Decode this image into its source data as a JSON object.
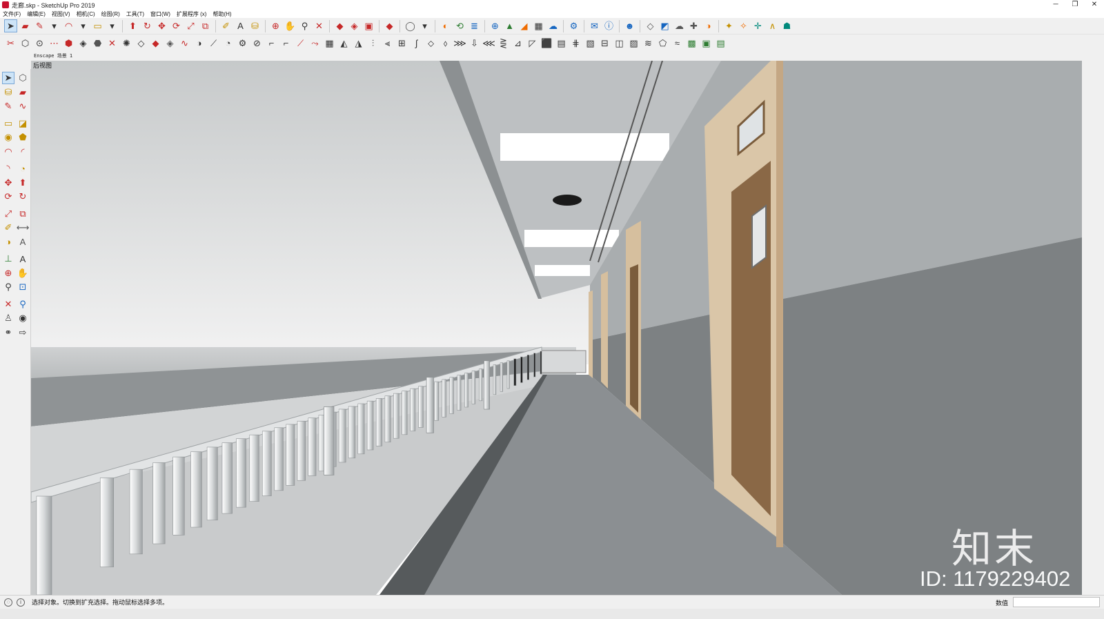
{
  "window": {
    "title": "走廊.skp - SketchUp Pro 2019",
    "controls": {
      "minimize": "─",
      "restore": "❐",
      "close": "✕"
    }
  },
  "menu": [
    "文件(F)",
    "编辑(E)",
    "视图(V)",
    "相机(C)",
    "绘图(R)",
    "工具(T)",
    "窗口(W)",
    "扩展程序 (x)",
    "帮助(H)"
  ],
  "toolbar_row1": [
    {
      "name": "select-icon",
      "glyph": "➤",
      "color": "dark",
      "selected": true
    },
    {
      "name": "eraser-icon",
      "glyph": "▰",
      "color": "red"
    },
    {
      "name": "pencil-icon",
      "glyph": "✎",
      "color": "red"
    },
    {
      "name": "line-dropdown-icon",
      "glyph": "▾",
      "color": "dark"
    },
    {
      "name": "arc-icon",
      "glyph": "◠",
      "color": "red"
    },
    {
      "name": "arc-dropdown-icon",
      "glyph": "▾",
      "color": "dark"
    },
    {
      "name": "rectangle-icon",
      "glyph": "▭",
      "color": "yellow"
    },
    {
      "name": "shape-dropdown-icon",
      "glyph": "▾",
      "color": "dark"
    },
    {
      "name": "sep"
    },
    {
      "name": "push-pull-icon",
      "glyph": "⬆",
      "color": "red"
    },
    {
      "name": "follow-me-icon",
      "glyph": "↻",
      "color": "red"
    },
    {
      "name": "move-icon",
      "glyph": "✥",
      "color": "red"
    },
    {
      "name": "rotate-icon",
      "glyph": "⟳",
      "color": "red"
    },
    {
      "name": "scale-icon",
      "glyph": "⤢",
      "color": "red"
    },
    {
      "name": "offset-icon",
      "glyph": "⧉",
      "color": "red"
    },
    {
      "name": "sep"
    },
    {
      "name": "tape-measure-icon",
      "glyph": "✐",
      "color": "yellow"
    },
    {
      "name": "text-icon",
      "glyph": "A",
      "color": "dark"
    },
    {
      "name": "paint-bucket-icon",
      "glyph": "⛁",
      "color": "yellow"
    },
    {
      "name": "sep"
    },
    {
      "name": "orbit-icon",
      "glyph": "⊕",
      "color": "red"
    },
    {
      "name": "pan-icon",
      "glyph": "✋",
      "color": "yellow"
    },
    {
      "name": "zoom-icon",
      "glyph": "⚲",
      "color": "dark"
    },
    {
      "name": "zoom-extents-icon",
      "glyph": "✕",
      "color": "red"
    },
    {
      "name": "sep"
    },
    {
      "name": "warehouse-icon",
      "glyph": "◆",
      "color": "red"
    },
    {
      "name": "extension-warehouse-icon",
      "glyph": "◈",
      "color": "red"
    },
    {
      "name": "share-model-icon",
      "glyph": "▣",
      "color": "red"
    },
    {
      "name": "sep"
    },
    {
      "name": "ruby-icon",
      "glyph": "◆",
      "color": "red"
    },
    {
      "name": "sep"
    },
    {
      "name": "account-icon",
      "glyph": "◯",
      "color": "gray"
    },
    {
      "name": "account-dropdown-icon",
      "glyph": "▾",
      "color": "dark"
    },
    {
      "name": "sep"
    },
    {
      "name": "enscape-start-icon",
      "glyph": "◐",
      "color": "orange"
    },
    {
      "name": "enscape-sync-icon",
      "glyph": "⟲",
      "color": "green"
    },
    {
      "name": "enscape-views-icon",
      "glyph": "≣",
      "color": "blue"
    },
    {
      "name": "sep"
    },
    {
      "name": "enscape-add-icon",
      "glyph": "⊕",
      "color": "blue"
    },
    {
      "name": "enscape-tree-icon",
      "glyph": "▲",
      "color": "green"
    },
    {
      "name": "enscape-asset-icon",
      "glyph": "◢",
      "color": "orange"
    },
    {
      "name": "enscape-material-icon",
      "glyph": "▦",
      "color": "dark"
    },
    {
      "name": "enscape-upload-icon",
      "glyph": "☁",
      "color": "blue"
    },
    {
      "name": "sep"
    },
    {
      "name": "enscape-settings-icon",
      "glyph": "⚙",
      "color": "blue"
    },
    {
      "name": "sep"
    },
    {
      "name": "enscape-feedback-icon",
      "glyph": "✉",
      "color": "blue"
    },
    {
      "name": "enscape-info-icon",
      "glyph": "ⓘ",
      "color": "blue"
    },
    {
      "name": "sep"
    },
    {
      "name": "enscape-account-icon",
      "glyph": "☻",
      "color": "blue"
    },
    {
      "name": "sep"
    },
    {
      "name": "section-plane-icon",
      "glyph": "◇",
      "color": "gray"
    },
    {
      "name": "section-display-icon",
      "glyph": "◩",
      "color": "blue"
    },
    {
      "name": "sandbox-icon",
      "glyph": "☁",
      "color": "gray"
    },
    {
      "name": "add-location-icon",
      "glyph": "✚",
      "color": "gray"
    },
    {
      "name": "toggle-terrain-icon",
      "glyph": "◑",
      "color": "orange"
    },
    {
      "name": "sep"
    },
    {
      "name": "interact-icon",
      "glyph": "✦",
      "color": "yellow"
    },
    {
      "name": "walk-icon",
      "glyph": "✧",
      "color": "orange"
    },
    {
      "name": "position-camera-icon",
      "glyph": "✛",
      "color": "teal"
    },
    {
      "name": "look-around-icon",
      "glyph": "∧",
      "color": "yellow"
    },
    {
      "name": "person-icon",
      "glyph": "☗",
      "color": "teal"
    }
  ],
  "toolbar_row2_count": 50,
  "scene": {
    "tab_label": "Enscape 场景 1"
  },
  "left_tools": [
    {
      "name": "select-icon",
      "glyph": "➤",
      "color": "dark",
      "selected": true
    },
    {
      "name": "make-component-icon",
      "glyph": "⬡",
      "color": "gray"
    },
    {
      "name": "paint-bucket-icon",
      "glyph": "⛁",
      "color": "yellow"
    },
    {
      "name": "eraser-icon",
      "glyph": "▰",
      "color": "red"
    },
    {
      "name": "line-icon",
      "glyph": "✎",
      "color": "red"
    },
    {
      "name": "freehand-icon",
      "glyph": "∿",
      "color": "red"
    },
    {
      "name": "rectangle-icon",
      "glyph": "▭",
      "color": "yellow"
    },
    {
      "name": "rotated-rectangle-icon",
      "glyph": "◪",
      "color": "yellow"
    },
    {
      "name": "circle-icon",
      "glyph": "◉",
      "color": "yellow"
    },
    {
      "name": "polygon-icon",
      "glyph": "⬟",
      "color": "yellow"
    },
    {
      "name": "arc-icon",
      "glyph": "◠",
      "color": "red"
    },
    {
      "name": "two-point-arc-icon",
      "glyph": "◜",
      "color": "red"
    },
    {
      "name": "three-point-arc-icon",
      "glyph": "◝",
      "color": "red"
    },
    {
      "name": "pie-icon",
      "glyph": "◔",
      "color": "yellow"
    },
    {
      "name": "move-icon",
      "glyph": "✥",
      "color": "red"
    },
    {
      "name": "push-pull-icon",
      "glyph": "⬆",
      "color": "red"
    },
    {
      "name": "rotate-icon",
      "glyph": "⟳",
      "color": "red"
    },
    {
      "name": "follow-me-icon",
      "glyph": "↻",
      "color": "red"
    },
    {
      "name": "scale-icon",
      "glyph": "⤢",
      "color": "red"
    },
    {
      "name": "offset-icon",
      "glyph": "⧉",
      "color": "red"
    },
    {
      "name": "tape-measure-icon",
      "glyph": "✐",
      "color": "yellow"
    },
    {
      "name": "dimension-icon",
      "glyph": "⟷",
      "color": "gray"
    },
    {
      "name": "protractor-icon",
      "glyph": "◑",
      "color": "yellow"
    },
    {
      "name": "text-icon",
      "glyph": "A",
      "color": "gray"
    },
    {
      "name": "axes-icon",
      "glyph": "⊥",
      "color": "green"
    },
    {
      "name": "3d-text-icon",
      "glyph": "A",
      "color": "dark"
    },
    {
      "name": "orbit-icon",
      "glyph": "⊕",
      "color": "red"
    },
    {
      "name": "pan-icon",
      "glyph": "✋",
      "color": "yellow"
    },
    {
      "name": "zoom-icon",
      "glyph": "⚲",
      "color": "dark"
    },
    {
      "name": "zoom-window-icon",
      "glyph": "⊡",
      "color": "blue"
    },
    {
      "name": "zoom-extents-icon",
      "glyph": "✕",
      "color": "red"
    },
    {
      "name": "previous-view-icon",
      "glyph": "⚲",
      "color": "blue"
    },
    {
      "name": "position-camera-icon",
      "glyph": "♙",
      "color": "gray"
    },
    {
      "name": "look-around-icon",
      "glyph": "◉",
      "color": "dark"
    },
    {
      "name": "walk-icon",
      "glyph": "⚭",
      "color": "dark"
    },
    {
      "name": "section-plane-icon",
      "glyph": "⇨",
      "color": "dark"
    }
  ],
  "viewport": {
    "view_label": "后视图",
    "watermark_logo": "知末",
    "watermark_id": "ID: 1179229402"
  },
  "status": {
    "text": "选择对象。切换到扩充选择。拖动鼠标选择多项。",
    "measurement_label": "数值",
    "measurement_value": ""
  },
  "colors": {
    "sky_top": "#c9cccd",
    "sky_bottom": "#f1f2f2",
    "wall": "#a6aaac",
    "wainscot": "#7c8082",
    "floor": "#8d9194",
    "door_wood": "#8c6a46",
    "door_frame": "#d9c2a3",
    "rail": "#e9ebec"
  }
}
